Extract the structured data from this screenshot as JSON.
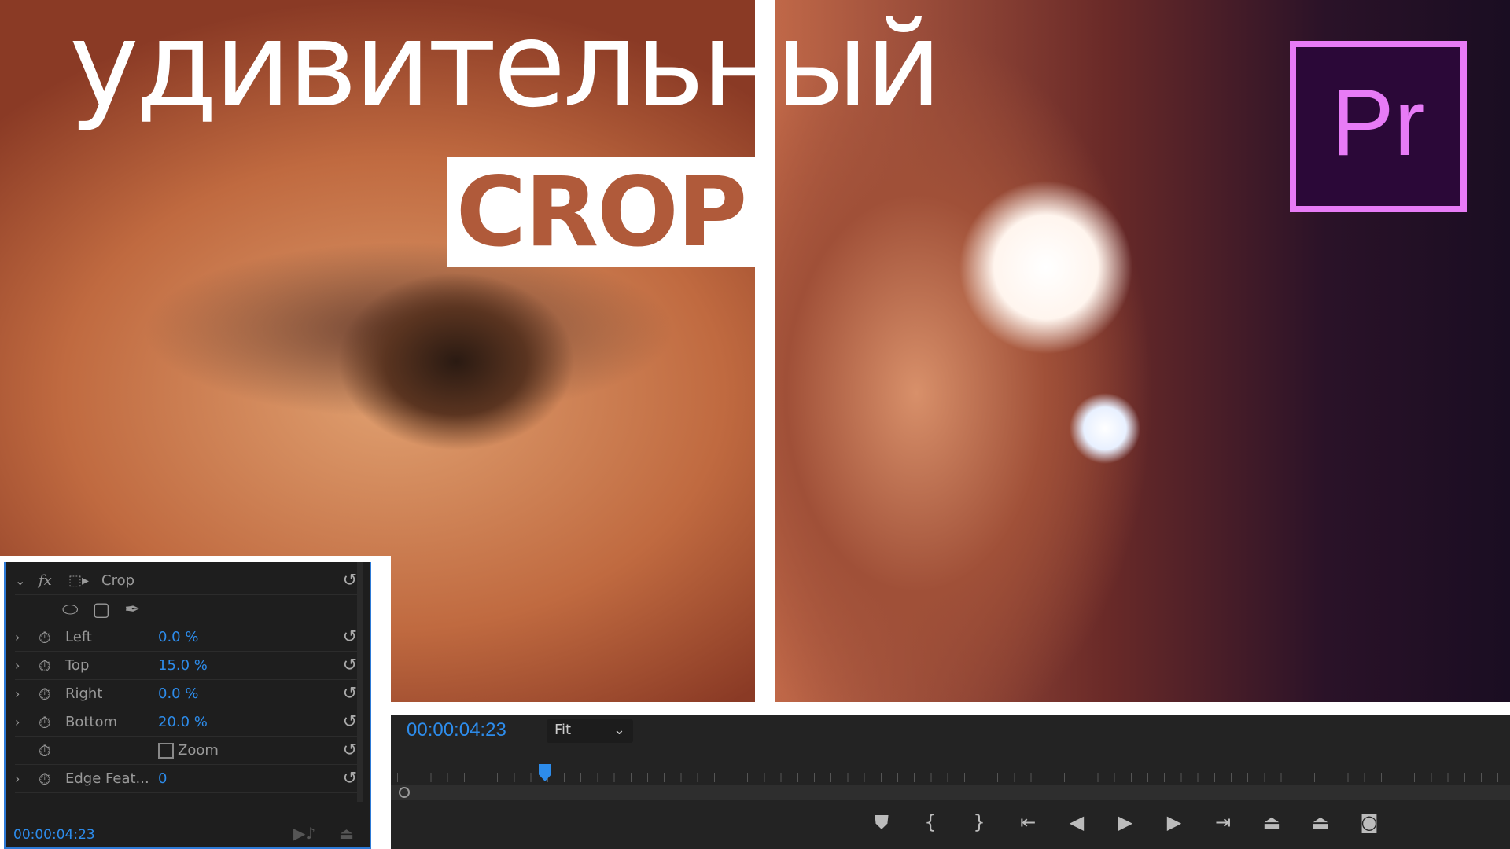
{
  "thumbnail": {
    "title": "удивительный",
    "subtitle": "CROP",
    "logo": "Pr",
    "logo_color": "#e77bf6"
  },
  "effect_controls": {
    "effect_name": "Crop",
    "mask_tools": [
      "ellipse-mask-icon",
      "rectangle-mask-icon",
      "pen-mask-icon"
    ],
    "properties": [
      {
        "label": "Left",
        "value": "0.0 %"
      },
      {
        "label": "Top",
        "value": "15.0 %"
      },
      {
        "label": "Right",
        "value": "0.0 %"
      },
      {
        "label": "Bottom",
        "value": "20.0 %"
      },
      {
        "label": "Zoom",
        "value": "",
        "checkbox": false
      },
      {
        "label": "Edge Feat...",
        "value": "0"
      }
    ],
    "timecode": "00:00:04:23"
  },
  "program_monitor": {
    "timecode": "00:00:04:23",
    "zoom": "Fit",
    "accent": "#2d8ceb",
    "controls": [
      "marker",
      "mark-in",
      "mark-out",
      "go-to-in",
      "step-back",
      "play",
      "step-forward",
      "go-to-out",
      "lift",
      "extract",
      "export-frame"
    ]
  }
}
